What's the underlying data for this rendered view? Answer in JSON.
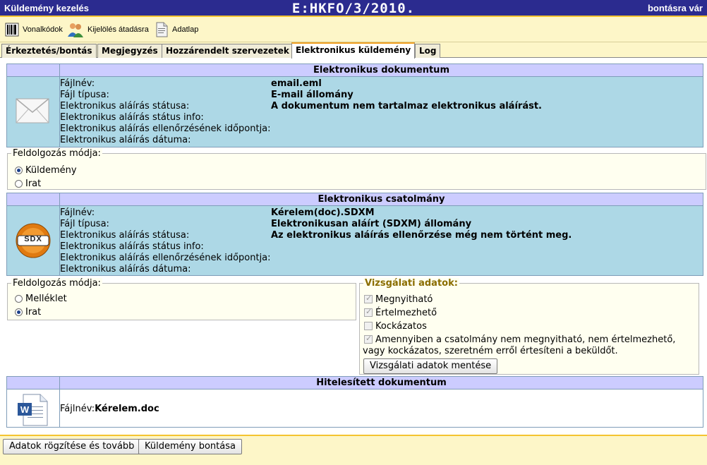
{
  "titlebar": {
    "app_name": "Küldemény kezelés",
    "record_code": "E:HKFO/3/2010.",
    "status": "bontásra vár"
  },
  "toolbar": {
    "items": [
      {
        "label": "Vonalkódok",
        "icon": "barcode-icon"
      },
      {
        "label": "Kijelölés átadásra",
        "icon": "users-icon"
      },
      {
        "label": "Adatlap",
        "icon": "document-icon"
      }
    ]
  },
  "tabs": [
    {
      "label": "Érkeztetés/bontás",
      "active": false
    },
    {
      "label": "Megjegyzés",
      "active": false
    },
    {
      "label": "Hozzárendelt szervezetek",
      "active": false
    },
    {
      "label": "Elektronikus küldemény",
      "active": true
    },
    {
      "label": "Log",
      "active": false
    }
  ],
  "electronic_document": {
    "title": "Elektronikus dokumentum",
    "icon": "envelope-icon",
    "rows": [
      {
        "key": "Fájlnév:",
        "value": "email.eml"
      },
      {
        "key": "Fájl típusa:",
        "value": "E-mail állomány"
      },
      {
        "key": "Elektronikus aláírás státusa:",
        "value": "A dokumentum nem tartalmaz elektronikus aláírást."
      },
      {
        "key": "Elektronikus aláírás státus info:",
        "value": ""
      },
      {
        "key": "Elektronikus aláírás ellenőrzésének időpontja:",
        "value": ""
      },
      {
        "key": "Elektronikus aláírás dátuma:",
        "value": ""
      }
    ]
  },
  "processing_mode_1": {
    "legend": "Feldolgozás módja:",
    "options": [
      {
        "label": "Küldemény",
        "checked": true
      },
      {
        "label": "Irat",
        "checked": false
      }
    ]
  },
  "electronic_attachment": {
    "title": "Elektronikus csatolmány",
    "icon": "sdx-icon",
    "icon_text": "SDX",
    "rows": [
      {
        "key": "Fájlnév:",
        "value": "Kérelem(doc).SDXM"
      },
      {
        "key": "Fájl típusa:",
        "value": "Elektronikusan aláírt (SDXM) állomány"
      },
      {
        "key": "Elektronikus aláírás státusa:",
        "value": "Az elektronikus aláírás ellenőrzése még nem történt meg."
      },
      {
        "key": "Elektronikus aláírás státus info:",
        "value": ""
      },
      {
        "key": "Elektronikus aláírás ellenőrzésének időpontja:",
        "value": ""
      },
      {
        "key": "Elektronikus aláírás dátuma:",
        "value": ""
      }
    ]
  },
  "processing_mode_2": {
    "legend": "Feldolgozás módja:",
    "options": [
      {
        "label": "Melléklet",
        "checked": false
      },
      {
        "label": "Irat",
        "checked": true
      }
    ]
  },
  "inspection": {
    "legend": "Vizsgálati adatok:",
    "checks": [
      {
        "label": "Megnyitható",
        "checked": true
      },
      {
        "label": "Értelmezhető",
        "checked": true
      },
      {
        "label": "Kockázatos",
        "checked": false
      }
    ],
    "notify_line1": "Amennyiben a csatolmány nem megnyitható, nem értelmezhető,",
    "notify_line2": "vagy kockázatos, szeretném erről értesíteni a beküldőt.",
    "notify_checked": true,
    "save_button": "Vizsgálati adatok mentése"
  },
  "authenticated_document": {
    "title": "Hitelesített dokumentum",
    "icon": "word-document-icon",
    "filename_label": "Fájlnév:",
    "filename_value": "Kérelem.doc"
  },
  "footer": {
    "save_continue": "Adatok rögzítése és tovább",
    "open_consignment": "Küldemény bontása"
  },
  "colors": {
    "title_bar": "#2b2b8f",
    "toolbar_bg": "#fdf6c8",
    "panel_bg": "#add8e6",
    "panel_header": "#ccccff",
    "accent": "#f4c430"
  }
}
